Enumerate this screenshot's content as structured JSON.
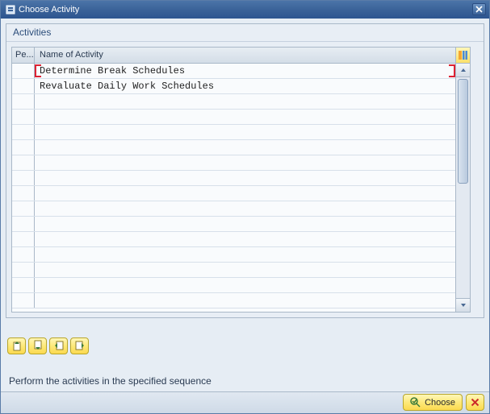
{
  "window": {
    "title": "Choose Activity"
  },
  "panel": {
    "title": "Activities"
  },
  "columns": {
    "pe": "Pe...",
    "name": "Name of Activity"
  },
  "rows": [
    {
      "pe": "",
      "name": "Determine Break Schedules",
      "selected": true
    },
    {
      "pe": "",
      "name": "Revaluate Daily Work Schedules",
      "selected": false
    }
  ],
  "emptyRowCount": 14,
  "instruction": "Perform the activities in the specified sequence",
  "footer": {
    "choose": "Choose"
  }
}
